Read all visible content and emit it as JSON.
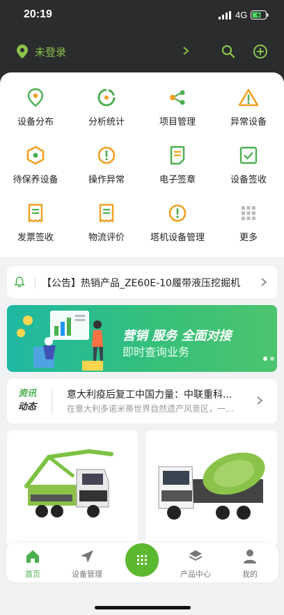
{
  "status_bar": {
    "time": "20:19",
    "network": "4G"
  },
  "header": {
    "login_label": "未登录"
  },
  "grid": [
    {
      "label": "设备分布",
      "icon": "location-pin-icon"
    },
    {
      "label": "分析统计",
      "icon": "pie-chart-icon"
    },
    {
      "label": "项目管理",
      "icon": "share-nodes-icon"
    },
    {
      "label": "异常设备",
      "icon": "warning-triangle-icon"
    },
    {
      "label": "待保养设备",
      "icon": "hexagon-maintenance-icon"
    },
    {
      "label": "操作异常",
      "icon": "alert-circle-icon"
    },
    {
      "label": "电子签章",
      "icon": "document-icon"
    },
    {
      "label": "设备签收",
      "icon": "checkbox-icon"
    },
    {
      "label": "发票签收",
      "icon": "invoice-icon"
    },
    {
      "label": "物流评价",
      "icon": "receipt-icon"
    },
    {
      "label": "塔机设备管理",
      "icon": "alert-circle-icon"
    },
    {
      "label": "更多",
      "icon": "grid-more-icon"
    }
  ],
  "notice": {
    "text": "【公告】热销产品_ZE60E-10履带液压挖掘机"
  },
  "banner": {
    "title": "营销 服务 全面对接",
    "subtitle": "即时查询业务"
  },
  "news": {
    "tag_line1": "资讯",
    "tag_line2": "动态",
    "title": "意大利疫后复工中国力量：中联重科...",
    "summary": "在意大利多诺米蒂世界自然遗产风景区，一..."
  },
  "tabs": [
    {
      "label": "首页",
      "icon": "home-icon",
      "active": true
    },
    {
      "label": "设备管理",
      "icon": "navigation-arrow-icon",
      "active": false
    },
    {
      "label": "产品中心",
      "icon": "layers-icon",
      "active": false
    },
    {
      "label": "我的",
      "icon": "person-icon",
      "active": false
    }
  ],
  "colors": {
    "accent": "#5cb82f",
    "icon_green": "#4caf50",
    "icon_orange": "#f0a020",
    "header_bg": "#2b2c2e"
  }
}
